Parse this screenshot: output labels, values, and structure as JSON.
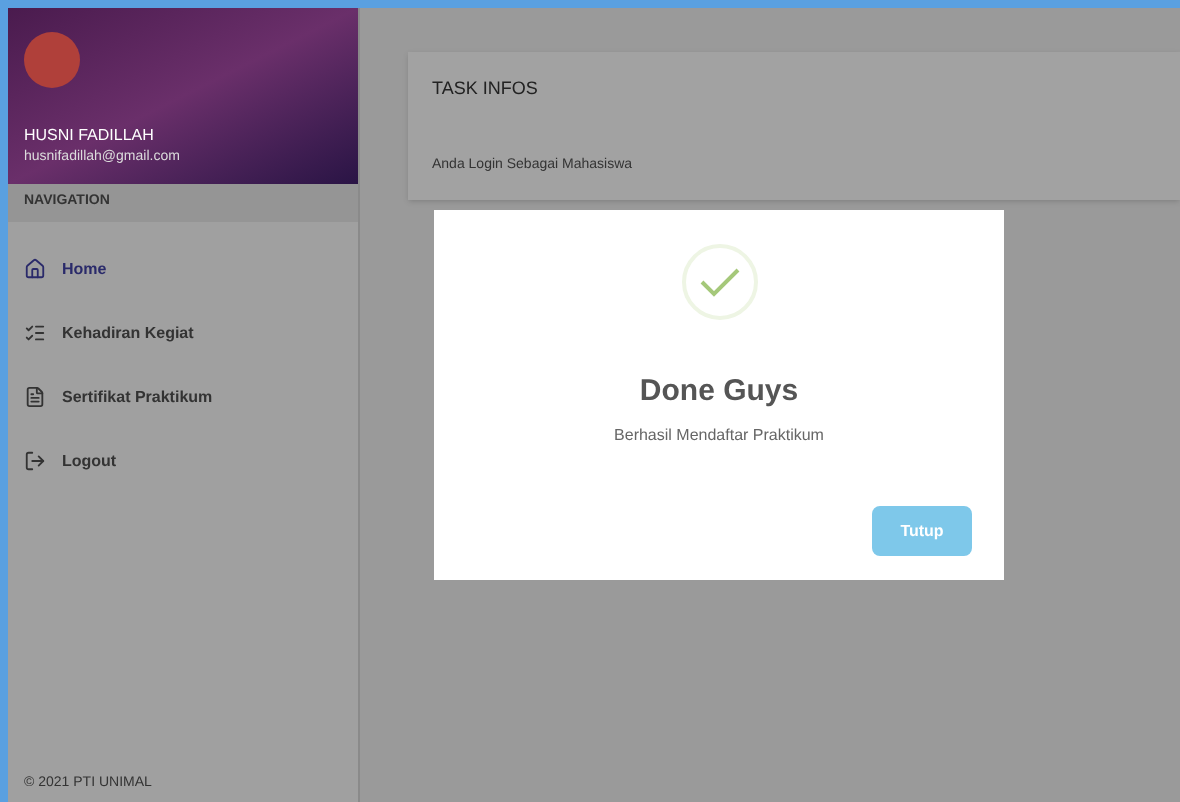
{
  "profile": {
    "name": "HUSNI FADILLAH",
    "email": "husnifadillah@gmail.com"
  },
  "nav_header": "NAVIGATION",
  "nav_items": [
    {
      "label": "Home",
      "selected": true
    },
    {
      "label": "Kehadiran Kegiat",
      "selected": false
    },
    {
      "label": "Sertifikat Praktikum",
      "selected": false
    },
    {
      "label": "Logout",
      "selected": false
    }
  ],
  "footer": "© 2021 PTI UNIMAL",
  "card": {
    "title": "TASK INFOS",
    "text": "Anda Login Sebagai Mahasiswa"
  },
  "dialog": {
    "title": "Done Guys",
    "message": "Berhasil Mendaftar Praktikum",
    "button": "Tutup"
  }
}
